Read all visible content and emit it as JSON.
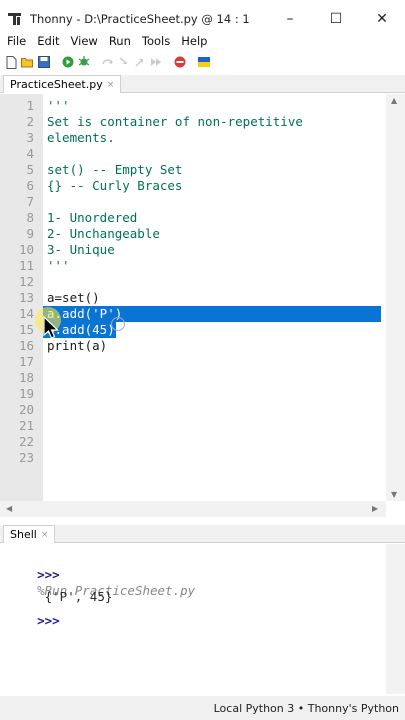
{
  "window": {
    "title": "Thonny  -  D:\\PracticeSheet.py  @  14 : 1",
    "minimize_glyph": "–",
    "maximize_glyph": "☐",
    "close_glyph": "✕"
  },
  "menu": {
    "items": [
      "File",
      "Edit",
      "View",
      "Run",
      "Tools",
      "Help"
    ]
  },
  "toolbar": {
    "icons": [
      "new-file-icon",
      "open-file-icon",
      "save-icon",
      "run-icon",
      "debug-icon",
      "step-over-icon",
      "step-into-icon",
      "step-out-icon",
      "resume-icon",
      "stop-icon",
      "ukraine-flag-icon"
    ]
  },
  "editor": {
    "tab_label": "PracticeSheet.py",
    "tab_close": "×",
    "lines": [
      {
        "num": "1",
        "text": "'''"
      },
      {
        "num": "2",
        "text": "Set is container of non-repetitive"
      },
      {
        "num": "3",
        "text": "elements."
      },
      {
        "num": "4",
        "text": ""
      },
      {
        "num": "5",
        "text": "set() -- Empty Set"
      },
      {
        "num": "6",
        "text": "{} -- Curly Braces"
      },
      {
        "num": "7",
        "text": ""
      },
      {
        "num": "8",
        "text": "1- Unordered"
      },
      {
        "num": "9",
        "text": "2- Unchangeable"
      },
      {
        "num": "10",
        "text": "3- Unique"
      },
      {
        "num": "11",
        "text": "'''"
      },
      {
        "num": "12",
        "text": ""
      },
      {
        "num": "13",
        "text": "a=set()"
      },
      {
        "num": "14",
        "text": "a.add('P')"
      },
      {
        "num": "15",
        "text": "a.add(45)"
      },
      {
        "num": "16",
        "text": "print(a)"
      },
      {
        "num": "17",
        "text": ""
      },
      {
        "num": "18",
        "text": ""
      },
      {
        "num": "19",
        "text": ""
      },
      {
        "num": "20",
        "text": ""
      },
      {
        "num": "21",
        "text": ""
      },
      {
        "num": "22",
        "text": ""
      },
      {
        "num": "23",
        "text": ""
      }
    ],
    "selected_lines": [
      14,
      15
    ]
  },
  "shell": {
    "tab_label": "Shell",
    "tab_close": "×",
    "prompt": ">>>",
    "run_command": "%Run PracticeSheet.py",
    "output": " {'P', 45}",
    "next_prompt": ">>>"
  },
  "status": {
    "text": "Local Python 3  •  Thonny's Python"
  },
  "colors": {
    "string": "#00705a",
    "selection": "#0a74d4",
    "gutter": "#e8e8e8",
    "prompt": "#1a1a9c"
  }
}
